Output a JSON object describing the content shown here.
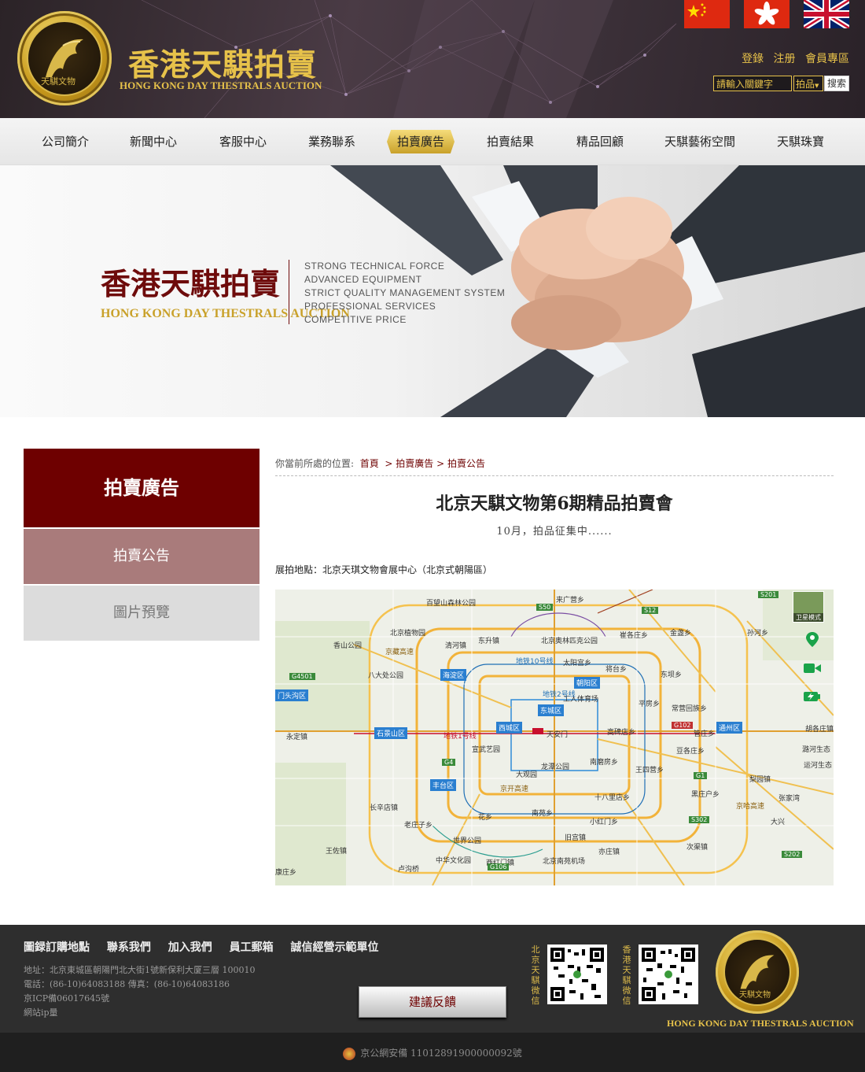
{
  "header": {
    "title": "香港天騏拍賣",
    "subtitle": "HONG KONG DAY THESTRALS AUCTION",
    "logo_text": "天騏文物",
    "user_links": [
      "登錄",
      "注册",
      "會員專區"
    ],
    "search": {
      "placeholder": "請輸入關鍵字",
      "category": "拍品",
      "button": "搜索"
    },
    "flags": [
      "china-flag",
      "hong-kong-flag",
      "uk-flag"
    ]
  },
  "nav": {
    "items": [
      "公司簡介",
      "新聞中心",
      "客服中心",
      "業務聯系",
      "拍賣廣告",
      "拍賣結果",
      "精品回顧",
      "天騏藝術空間",
      "天騏珠寶"
    ],
    "active": "拍賣廣告"
  },
  "banner": {
    "title": "香港天騏拍賣",
    "subtitle": "HONG KONG DAY THESTRALS AUCTION",
    "lines": [
      "STRONG TECHNICAL FORCE",
      "ADVANCED EQUIPMENT",
      "STRICT QUALITY MANAGEMENT SYSTEM",
      "PROFESSIONAL SERVICES",
      "COMPETITIVE PRICE"
    ]
  },
  "sidebar": {
    "heading": "拍賣廣告",
    "items": [
      "拍賣公告",
      "圖片預覽"
    ]
  },
  "content": {
    "breadcrumb_prefix": "你當前所處的位置:",
    "breadcrumb": [
      "首頁",
      "拍賣廣告",
      "拍賣公告"
    ],
    "title": "北京天騏文物第6期精品拍賣會",
    "subtitle": "10月，拍品征集中......",
    "venue": "展拍地點：北京天琪文物會展中心（北京式朝陽區）"
  },
  "map": {
    "satellite_label": "卫星模式",
    "badges": [
      "海淀区",
      "朝阳区",
      "东城区",
      "西城区",
      "石景山区",
      "丰台区",
      "通州区",
      "门头沟区"
    ],
    "labels": [
      "百望山森林公园",
      "北京植物园",
      "香山公园",
      "八大处公园",
      "永定镇",
      "长辛店镇",
      "北京奥林匹克公园",
      "天安门",
      "大观园",
      "龙潭公园",
      "南苑乡",
      "北京南苑机场",
      "世界公园",
      "中华文化园",
      "王佐镇",
      "平房乡",
      "高碑店乡",
      "管庄乡",
      "黑庄户乡",
      "十八里店乡",
      "亦庄镇",
      "次渠镇",
      "梨园镇",
      "张家湾",
      "来广营乡",
      "孙河乡",
      "金盏乡",
      "崔各庄乡",
      "东坝乡",
      "将台乡",
      "太阳宫乡",
      "东升镇",
      "清河镇",
      "大兴",
      "花乡",
      "老庄子乡",
      "南磨房乡",
      "王四营乡",
      "潞河生态",
      "胡各庄镇",
      "运河生态",
      "常营回族乡",
      "豆各庄乡",
      "小红门乡",
      "旧宫镇",
      "西红门镇",
      "卢沟桥",
      "宣武艺园",
      "工人体育场",
      "康庄乡"
    ],
    "roads": [
      "S50",
      "S12",
      "G4501",
      "G4",
      "G1",
      "G106",
      "G102",
      "S202",
      "S302",
      "S201",
      "京哈高速",
      "京藏高速",
      "京开高速",
      "地铁1号线",
      "地铁2号线",
      "地铁10号线"
    ]
  },
  "footer": {
    "links": [
      "圖録訂購地點",
      "聯系我們",
      "加入我們",
      "員工郵箱",
      "誠信經營示範單位"
    ],
    "info": [
      "地址：北京東城區朝陽門北大街1號新保利大厦三層 100010",
      "電話：(86-10)64083188 傳真：(86-10)64083186",
      "京ICP備06017645號",
      "網站ip量"
    ],
    "feedback_button": "建議反饋",
    "qr_labels": [
      "北京天騏微信",
      "香港天騏微信"
    ],
    "logo_text": "天騏文物",
    "logo_subtitle": "HONG KONG DAY THESTRALS AUCTION",
    "icp": "京公網安備 11012891900000092號"
  },
  "colors": {
    "brand_red": "#6e0000",
    "gold": "#e7c24a",
    "sidebar_active": "#a97b7b"
  }
}
